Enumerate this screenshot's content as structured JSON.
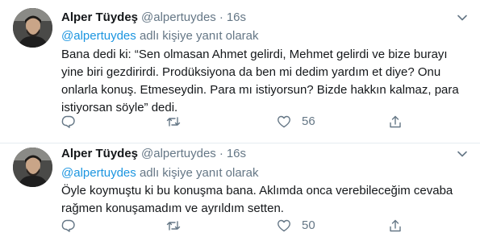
{
  "tweets": [
    {
      "name": "Alper Tüydeş",
      "handle": "@alpertuydes",
      "separator": "·",
      "time": "16s",
      "reply_mention": "@alpertuydes",
      "reply_suffix": " adlı kişiye yanıt olarak",
      "lines": [
        "Bana dedi ki: “Sen olmasan Ahmet gelirdi, Mehmet gelirdi ve bize burayı",
        "yine biri gezdirirdi. Prodüksiyona da ben mi dedim yardım et diye? Onu",
        "onlarla konuş. Etmeseydin. Para mı istiyorsun? Bizde hakkın kalmaz, para",
        "istiyorsan söyle” dedi."
      ],
      "likes": "56"
    },
    {
      "name": "Alper Tüydeş",
      "handle": "@alpertuydes",
      "separator": "·",
      "time": "16s",
      "reply_mention": "@alpertuydes",
      "reply_suffix": " adlı kişiye yanıt olarak",
      "lines": [
        "Öyle koymuştu ki bu konuşma bana. Aklımda onca verebileceğim cevaba",
        "rağmen konuşamadım ve ayrıldım setten."
      ],
      "likes": "50"
    }
  ],
  "icons": {
    "reply": "reply-icon",
    "retweet": "retweet-icon",
    "like": "heart-icon",
    "share": "share-icon",
    "more": "chevron-down-icon"
  },
  "colors": {
    "text": "#14171a",
    "muted": "#657786",
    "link": "#1b95e0",
    "divider": "#e6ecf0"
  }
}
